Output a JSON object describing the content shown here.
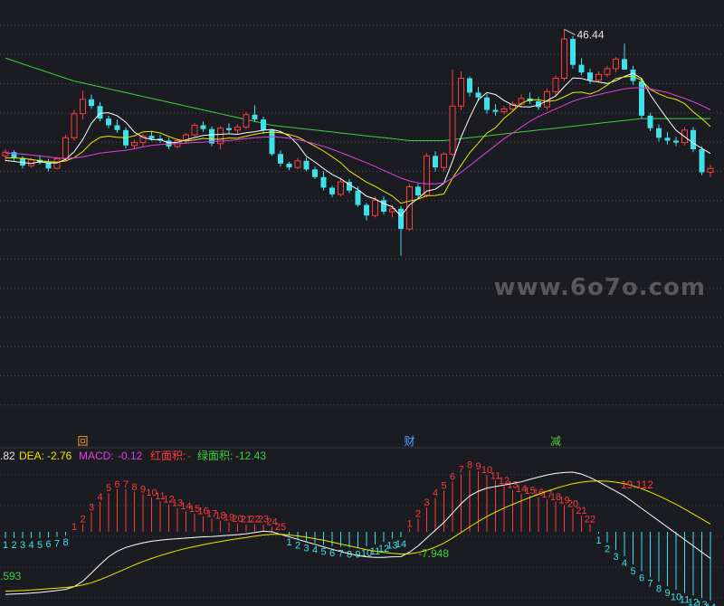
{
  "watermark": "www.6o7o.com",
  "price_panel": {
    "peak_label": "46.44",
    "colors": {
      "up": "#ff3b3b",
      "down": "#3ee0ea",
      "ma5": "#ffffff",
      "ma10": "#e8e800",
      "ma20": "#e040e0",
      "ma60": "#3fd03f"
    }
  },
  "markers": [
    {
      "text": "回",
      "color": "#f0a030"
    },
    {
      "text": "财",
      "color": "#4aa8ff"
    },
    {
      "text": "减",
      "color": "#3fd03f"
    }
  ],
  "macd_header": {
    "dif_value": ".82",
    "dea_label": "DEA:",
    "dea_value": "-2.76",
    "macd_label": "MACD:",
    "macd_value": "-0.12",
    "red_area_label": "红面积:",
    "red_area_value": "-",
    "green_area_label": "绿面积:",
    "green_area_value": "-12.43"
  },
  "macd_annotations": {
    "low_right": "-7.948",
    "high": "19.112",
    "low_left": ".593"
  },
  "chart_data": [
    {
      "type": "candlestick",
      "title": "",
      "series": [
        {
          "name": "candles",
          "values": [
            [
              33.2,
              33.9,
              32.6,
              33.6
            ],
            [
              33.6,
              33.8,
              32.7,
              33.0
            ],
            [
              33.0,
              33.2,
              31.9,
              32.2
            ],
            [
              32.2,
              33.0,
              32.0,
              32.8
            ],
            [
              32.8,
              33.3,
              32.3,
              32.5
            ],
            [
              32.5,
              32.9,
              31.6,
              31.9
            ],
            [
              31.9,
              33.1,
              31.8,
              32.9
            ],
            [
              32.9,
              35.4,
              32.7,
              35.1
            ],
            [
              35.1,
              38.0,
              34.8,
              37.6
            ],
            [
              37.6,
              40.0,
              37.0,
              39.1
            ],
            [
              39.1,
              39.6,
              38.1,
              38.4
            ],
            [
              38.4,
              38.8,
              36.8,
              37.1
            ],
            [
              37.1,
              37.4,
              36.1,
              36.4
            ],
            [
              36.4,
              37.0,
              35.6,
              35.9
            ],
            [
              35.9,
              36.2,
              34.0,
              34.3
            ],
            [
              34.3,
              34.9,
              33.9,
              34.6
            ],
            [
              34.6,
              35.5,
              34.2,
              35.3
            ],
            [
              35.3,
              35.8,
              34.8,
              35.0
            ],
            [
              35.0,
              35.4,
              34.6,
              34.8
            ],
            [
              34.8,
              35.1,
              33.9,
              34.2
            ],
            [
              34.2,
              35.0,
              34.0,
              34.8
            ],
            [
              34.8,
              35.6,
              34.5,
              35.4
            ],
            [
              35.4,
              36.6,
              35.2,
              36.4
            ],
            [
              36.4,
              36.8,
              35.7,
              36.0
            ],
            [
              36.0,
              36.3,
              34.2,
              34.5
            ],
            [
              34.5,
              36.3,
              33.9,
              36.1
            ],
            [
              36.1,
              36.6,
              35.6,
              35.9
            ],
            [
              35.9,
              36.5,
              35.4,
              36.2
            ],
            [
              36.2,
              37.8,
              36.0,
              37.5
            ],
            [
              37.5,
              38.5,
              36.8,
              37.0
            ],
            [
              37.0,
              37.3,
              35.5,
              35.9
            ],
            [
              35.9,
              36.0,
              33.2,
              33.4
            ],
            [
              33.4,
              33.8,
              32.1,
              32.4
            ],
            [
              32.4,
              32.6,
              31.7,
              32.0
            ],
            [
              32.0,
              33.0,
              31.8,
              32.7
            ],
            [
              32.7,
              33.0,
              31.6,
              31.8
            ],
            [
              31.8,
              32.1,
              30.8,
              31.0
            ],
            [
              31.0,
              31.6,
              29.6,
              29.9
            ],
            [
              29.9,
              30.1,
              28.9,
              29.2
            ],
            [
              29.2,
              30.9,
              29.0,
              30.5
            ],
            [
              30.5,
              30.8,
              29.3,
              29.6
            ],
            [
              29.6,
              30.0,
              27.9,
              28.1
            ],
            [
              28.1,
              28.3,
              26.5,
              27.0
            ],
            [
              27.0,
              29.0,
              26.8,
              28.6
            ],
            [
              28.6,
              29.0,
              27.1,
              27.4
            ],
            [
              27.4,
              28.1,
              26.8,
              27.7
            ],
            [
              27.7,
              28.0,
              22.8,
              25.6
            ],
            [
              25.6,
              30.3,
              25.4,
              30.0
            ],
            [
              30.0,
              30.3,
              28.7,
              29.1
            ],
            [
              29.1,
              33.5,
              28.9,
              33.2
            ],
            [
              33.2,
              33.7,
              31.6,
              32.0
            ],
            [
              32.0,
              33.6,
              31.6,
              33.4
            ],
            [
              33.4,
              42.2,
              33.2,
              38.4
            ],
            [
              38.4,
              42.0,
              38.0,
              41.3
            ],
            [
              41.3,
              41.5,
              39.4,
              39.8
            ],
            [
              39.8,
              40.4,
              38.9,
              39.3
            ],
            [
              39.3,
              39.7,
              37.6,
              38.0
            ],
            [
              38.0,
              38.6,
              37.4,
              37.8
            ],
            [
              37.8,
              38.4,
              37.5,
              38.1
            ],
            [
              38.1,
              38.9,
              37.9,
              38.6
            ],
            [
              38.6,
              39.6,
              38.3,
              39.2
            ],
            [
              39.2,
              39.8,
              38.6,
              38.9
            ],
            [
              38.9,
              39.4,
              38.0,
              38.3
            ],
            [
              38.3,
              40.2,
              38.0,
              39.9
            ],
            [
              39.9,
              41.6,
              39.5,
              41.3
            ],
            [
              41.3,
              46.4,
              41.0,
              45.4
            ],
            [
              45.4,
              45.7,
              42.3,
              42.7
            ],
            [
              42.7,
              43.4,
              41.6,
              41.9
            ],
            [
              41.9,
              42.3,
              40.7,
              41.1
            ],
            [
              41.1,
              42.0,
              40.8,
              41.7
            ],
            [
              41.7,
              42.6,
              41.4,
              42.3
            ],
            [
              42.3,
              43.5,
              41.9,
              43.3
            ],
            [
              43.3,
              44.9,
              42.8,
              42.2
            ],
            [
              42.2,
              42.6,
              40.6,
              41.0
            ],
            [
              41.0,
              41.3,
              37.1,
              37.4
            ],
            [
              37.4,
              37.7,
              35.8,
              36.1
            ],
            [
              36.1,
              36.5,
              34.7,
              35.1
            ],
            [
              35.1,
              35.7,
              34.4,
              34.8
            ],
            [
              34.8,
              35.2,
              34.2,
              34.6
            ],
            [
              34.6,
              36.2,
              34.3,
              35.9
            ],
            [
              35.9,
              36.2,
              33.6,
              33.9
            ],
            [
              33.9,
              34.2,
              31.2,
              31.5
            ],
            [
              31.5,
              32.3,
              31.0,
              31.9
            ]
          ]
        },
        {
          "name": "MA5",
          "values": [
            32.73,
            32.63,
            32.53,
            32.42,
            32.61,
            32.48,
            32.48,
            32.84,
            33.65,
            34.91,
            36.61,
            37.65,
            37.71,
            37.39,
            36.72,
            35.69,
            35.14,
            34.9,
            34.9,
            34.56,
            34.63,
            34.88,
            35.12,
            35.33,
            35.41,
            35.46,
            35.51,
            35.46,
            35.63,
            35.73,
            35.89,
            35.97,
            35.74,
            35.29,
            34.39,
            33.17,
            32.57,
            31.89,
            31.28,
            30.82,
            30.22,
            29.7,
            29.01,
            28.71,
            28.25,
            27.91,
            26.94,
            28.11,
            28.78,
            29.55,
            29.74,
            30.37,
            32.66,
            35.17,
            37.22,
            39.05,
            39.81,
            39.6,
            38.97,
            38.5,
            38.33,
            38.31,
            38.5,
            38.97,
            39.44,
            40.41,
            41.33,
            41.28,
            41.03,
            40.91,
            40.75,
            41.04,
            41.49,
            41.81,
            41.26,
            39.57,
            38.29,
            37.04,
            35.88,
            35.2,
            34.54,
            34.0,
            33.46
          ]
        },
        {
          "name": "MA10",
          "values": [
            33.0,
            33.0,
            32.95,
            32.85,
            32.7,
            32.6,
            32.55,
            32.68,
            33.03,
            33.66,
            34.57,
            35.14,
            35.27,
            35.15,
            35.1,
            35.31,
            35.7,
            35.77,
            35.6,
            35.23,
            34.91,
            34.75,
            34.87,
            35.03,
            34.95,
            34.95,
            35.07,
            35.04,
            35.26,
            35.47,
            35.61,
            35.7,
            35.63,
            35.44,
            35.17,
            34.7,
            34.22,
            33.71,
            33.12,
            32.49,
            31.63,
            31.06,
            30.46,
            30.04,
            29.53,
            29.02,
            28.28,
            28.5,
            28.7,
            29.06,
            29.09,
            29.25,
            30.89,
            32.23,
            33.53,
            34.54,
            35.59,
            36.14,
            37.12,
            37.86,
            38.69,
            39.06,
            39.05,
            38.89,
            38.98,
            39.37,
            39.8,
            39.85,
            39.65,
            40.0,
            40.58,
            41.27,
            41.43,
            41.52,
            41.08,
            40.15,
            39.67,
            39.3,
            39.09,
            38.65,
            37.79,
            37.1,
            36.26
          ]
        },
        {
          "name": "MA20",
          "values": [
            33.5,
            33.45,
            33.4,
            33.3,
            33.2,
            33.1,
            33.0,
            32.95,
            33.0,
            33.1,
            33.3,
            33.5,
            33.6,
            33.7,
            33.8,
            33.95,
            34.15,
            34.3,
            34.4,
            34.45,
            34.5,
            34.55,
            34.6,
            34.65,
            34.7,
            34.75,
            34.8,
            34.9,
            35.0,
            35.1,
            35.15,
            35.2,
            35.15,
            35.05,
            34.9,
            34.7,
            34.45,
            34.2,
            33.9,
            33.55,
            33.2,
            32.85,
            32.5,
            32.1,
            31.7,
            31.3,
            30.9,
            30.6,
            30.4,
            30.3,
            30.3,
            30.4,
            30.9,
            31.5,
            32.2,
            32.9,
            33.6,
            34.3,
            35.0,
            35.6,
            36.2,
            36.8,
            37.3,
            37.7,
            38.1,
            38.5,
            38.9,
            39.2,
            39.4,
            39.6,
            39.8,
            40.0,
            40.2,
            40.3,
            40.3,
            40.2,
            40.0,
            39.8,
            39.5,
            39.2,
            38.85,
            38.45,
            38.0
          ]
        },
        {
          "name": "MA60",
          "values": [
            43.4,
            43.1,
            42.8,
            42.5,
            42.2,
            41.9,
            41.6,
            41.3,
            41.0,
            40.8,
            40.6,
            40.4,
            40.2,
            40.0,
            39.8,
            39.6,
            39.4,
            39.2,
            39.0,
            38.8,
            38.6,
            38.4,
            38.2,
            38.0,
            37.8,
            37.6,
            37.4,
            37.2,
            37.0,
            36.8,
            36.6,
            36.4,
            36.3,
            36.2,
            36.1,
            36.0,
            35.9,
            35.8,
            35.7,
            35.6,
            35.5,
            35.4,
            35.3,
            35.2,
            35.1,
            35.0,
            34.9,
            34.8,
            34.8,
            34.8,
            34.8,
            34.8,
            34.9,
            35.0,
            35.1,
            35.2,
            35.3,
            35.4,
            35.5,
            35.6,
            35.7,
            35.8,
            35.9,
            36.0,
            36.1,
            36.2,
            36.3,
            36.4,
            36.5,
            36.6,
            36.7,
            36.8,
            36.9,
            37.0,
            37.1,
            37.1,
            37.1,
            37.1,
            37.1,
            37.1,
            37.1,
            37.1,
            37.1
          ]
        }
      ],
      "annotations": [
        "46.44"
      ]
    },
    {
      "type": "macd",
      "series": [
        {
          "name": "DIF",
          "values": [
            -20.0,
            -19.9,
            -19.8,
            -19.6,
            -19.4,
            -19.1,
            -18.8,
            -18.4,
            -17.5,
            -15.8,
            -13.2,
            -10.5,
            -8.0,
            -6.2,
            -5.0,
            -4.2,
            -3.5,
            -3.0,
            -2.7,
            -2.4,
            -2.2,
            -2.0,
            -1.8,
            -1.6,
            -1.5,
            -1.3,
            -1.1,
            -0.9,
            -0.6,
            -0.2,
            0.2,
            0.0,
            -0.8,
            -1.6,
            -2.4,
            -3.2,
            -4.0,
            -4.8,
            -5.6,
            -6.3,
            -7.0,
            -7.6,
            -8.0,
            -8.2,
            -8.2,
            -8.0,
            -7.95,
            -6.5,
            -4.5,
            -2.0,
            0.5,
            3.0,
            6.0,
            9.0,
            11.5,
            13.0,
            14.0,
            14.5,
            15.0,
            15.5,
            16.0,
            16.8,
            17.5,
            18.2,
            18.7,
            19.0,
            19.11,
            18.5,
            17.4,
            16.0,
            14.5,
            13.0,
            11.5,
            9.5,
            7.5,
            5.5,
            3.5,
            1.5,
            -0.5,
            -2.5,
            -4.5,
            -6.5,
            -8.5
          ]
        },
        {
          "name": "DEA",
          "values": [
            -19.0,
            -18.9,
            -18.8,
            -18.6,
            -18.4,
            -18.2,
            -18.0,
            -17.8,
            -17.5,
            -17.0,
            -16.3,
            -15.3,
            -14.2,
            -13.0,
            -11.8,
            -10.6,
            -9.5,
            -8.5,
            -7.6,
            -6.8,
            -6.0,
            -5.3,
            -4.7,
            -4.1,
            -3.6,
            -3.1,
            -2.6,
            -2.2,
            -1.8,
            -1.4,
            -1.0,
            -0.8,
            -0.8,
            -1.0,
            -1.3,
            -1.7,
            -2.2,
            -2.7,
            -3.3,
            -3.9,
            -4.5,
            -5.1,
            -5.7,
            -6.2,
            -6.6,
            -6.9,
            -7.1,
            -7.0,
            -6.6,
            -5.9,
            -4.9,
            -3.6,
            -2.0,
            -0.2,
            1.6,
            3.3,
            4.9,
            6.3,
            7.6,
            8.8,
            9.9,
            11.0,
            12.0,
            13.0,
            13.9,
            14.7,
            15.4,
            15.9,
            16.2,
            16.3,
            16.2,
            15.9,
            15.4,
            14.7,
            13.8,
            12.7,
            11.5,
            10.2,
            8.8,
            7.3,
            5.7,
            4.1,
            2.5
          ]
        }
      ]
    }
  ]
}
